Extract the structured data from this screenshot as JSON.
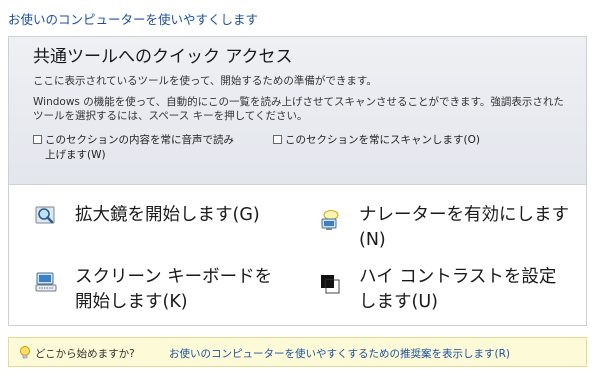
{
  "page": {
    "title": "お使いのコンピューターを使いやすくします"
  },
  "quick_access": {
    "title": "共通ツールへのクイック アクセス",
    "desc1": "ここに表示されているツールを使って、開始するための準備ができます。",
    "desc2": "Windows の機能を使って、自動的にこの一覧を読み上げさせてスキャンさせることができます。強調表示されたツールを選択するには、スペース キーを押してください。",
    "checkbox_read_aloud": "このセクションの内容を常に音声で読み上げます(W)",
    "checkbox_scan": "このセクションを常にスキャンします(O)",
    "read_aloud_checked": false,
    "scan_checked": false
  },
  "tools": {
    "magnifier": "拡大鏡を開始します(G)",
    "narrator": "ナレーターを有効にします(N)",
    "osk": "スクリーン キーボードを開始します(K)",
    "high_contrast": "ハイ コントラストを設定します(U)"
  },
  "hint": {
    "prefix": "どこから始めますか?",
    "link": "お使いのコンピューターを使いやすくするための推奨案を表示します(R)"
  },
  "icons": {
    "magnifier": "magnifier-icon",
    "narrator": "narrator-icon",
    "osk": "keyboard-icon",
    "high_contrast": "contrast-icon",
    "hint": "lightbulb-icon"
  },
  "colors": {
    "link": "#1e50a2",
    "hint_bg": "#fdfbd7",
    "header_bg": "#e6e9ee"
  }
}
